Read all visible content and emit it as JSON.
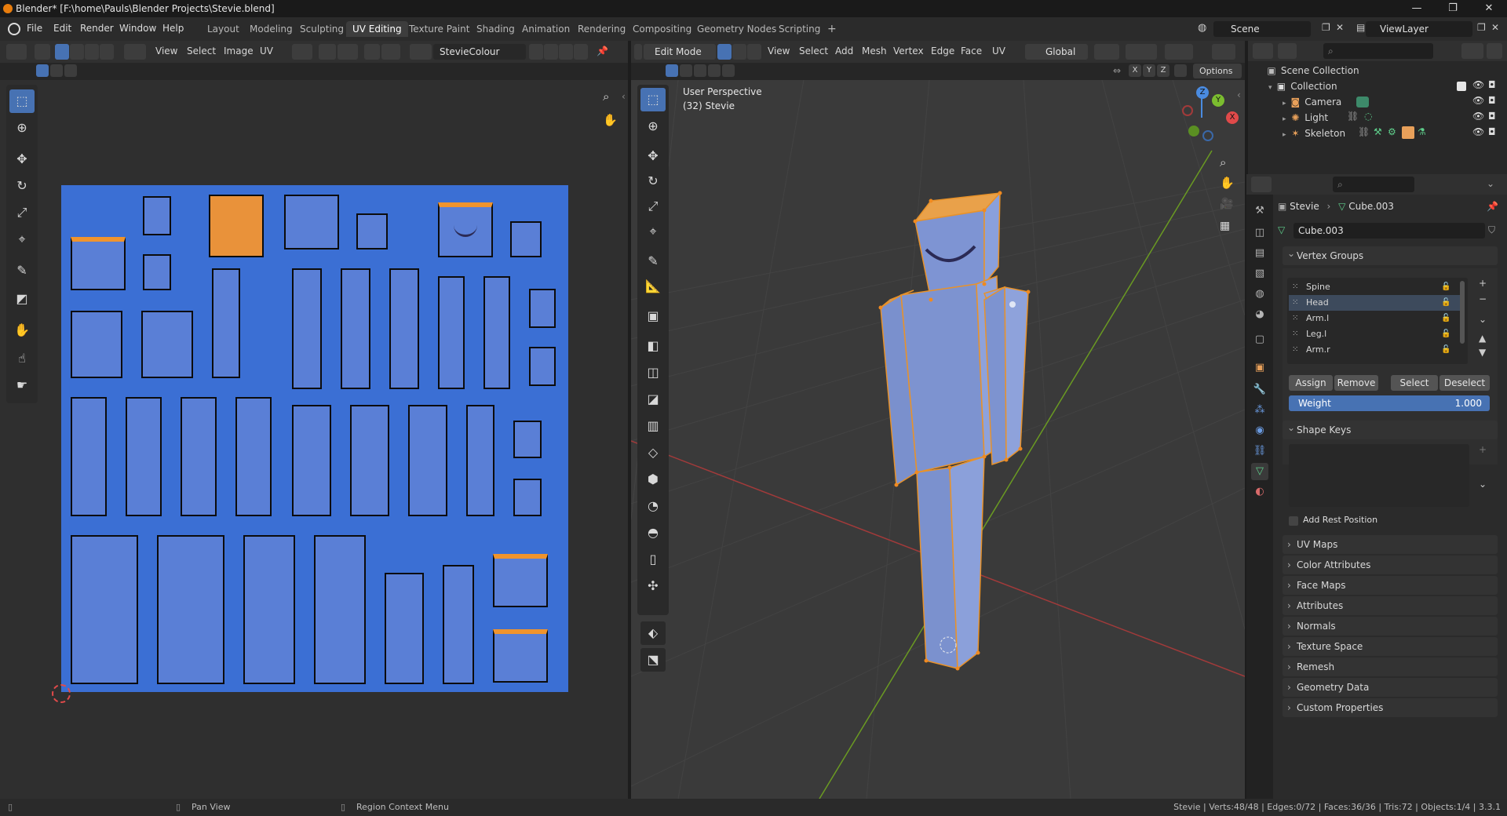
{
  "window": {
    "title": "Blender* [F:\\home\\Pauls\\Blender Projects\\Stevie.blend]",
    "minimize": "—",
    "maximize": "❐",
    "close": "✕"
  },
  "menubar": {
    "menus": [
      "File",
      "Edit",
      "Render",
      "Window",
      "Help"
    ],
    "workspaces": [
      "Layout",
      "Modeling",
      "Sculpting",
      "UV Editing",
      "Texture Paint",
      "Shading",
      "Animation",
      "Rendering",
      "Compositing",
      "Geometry Nodes",
      "Scripting"
    ],
    "active_workspace": "UV Editing",
    "add_tab": "+",
    "scene": "Scene",
    "view_layer": "ViewLayer"
  },
  "uv_editor": {
    "menus": [
      "View",
      "Select",
      "Image",
      "UV"
    ],
    "image_name": "StevieColour",
    "accent_color": "#4772b3",
    "background_color": "#3b6fd4"
  },
  "viewport": {
    "mode": "Edit Mode",
    "menus": [
      "View",
      "Select",
      "Add",
      "Mesh",
      "Vertex",
      "Edge",
      "Face",
      "UV"
    ],
    "transform_orientation": "Global",
    "overlay_title": "User Perspective",
    "overlay_object": "(32) Stevie",
    "axis_labels": [
      "X",
      "Y",
      "Z"
    ],
    "options_label": "Options",
    "gizmo": {
      "x": "X",
      "y": "Y",
      "z": "Z"
    }
  },
  "outliner": {
    "root": "Scene Collection",
    "collection": "Collection",
    "items": [
      {
        "name": "Camera",
        "icon": "camera-icon"
      },
      {
        "name": "Light",
        "icon": "light-icon"
      },
      {
        "name": "Skeleton",
        "icon": "armature-icon"
      }
    ]
  },
  "properties": {
    "breadcrumb": {
      "object": "Stevie",
      "mesh": "Cube.003"
    },
    "mesh_name": "Cube.003",
    "vertex_groups": {
      "title": "Vertex Groups",
      "items": [
        "Spine",
        "Head",
        "Arm.l",
        "Leg.l",
        "Arm.r"
      ],
      "selected": "Head",
      "buttons": {
        "assign": "Assign",
        "remove": "Remove",
        "select": "Select",
        "deselect": "Deselect"
      },
      "weight_label": "Weight",
      "weight_value": "1.000"
    },
    "shape_keys": {
      "title": "Shape Keys",
      "add_rest_position": "Add Rest Position"
    },
    "panels": [
      "UV Maps",
      "Color Attributes",
      "Face Maps",
      "Attributes",
      "Normals",
      "Texture Space",
      "Remesh",
      "Geometry Data",
      "Custom Properties"
    ]
  },
  "statusbar": {
    "pan_view": "Pan View",
    "context_menu": "Region Context Menu",
    "stats": "Stevie | Verts:48/48 | Edges:0/72 | Faces:36/36 | Tris:72 | Objects:1/4 | 3.3.1"
  }
}
